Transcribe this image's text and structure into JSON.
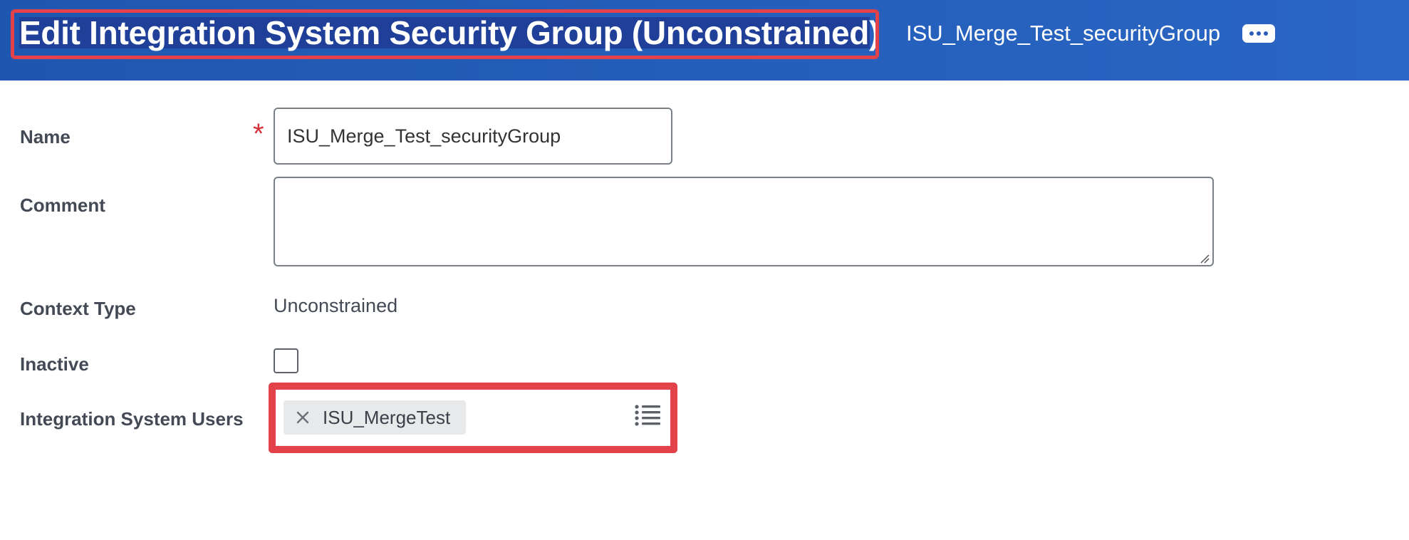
{
  "header": {
    "title": "Edit Integration System Security Group (Unconstrained)",
    "subtitle": "ISU_Merge_Test_securityGroup",
    "more_icon": "ellipsis-icon",
    "colors": {
      "background": "#2a66c4",
      "highlight_border": "#e3424a",
      "title_selection": "#1f3f99"
    }
  },
  "form": {
    "name": {
      "label": "Name",
      "required_marker": "*",
      "value": "ISU_Merge_Test_securityGroup"
    },
    "comment": {
      "label": "Comment",
      "value": ""
    },
    "context_type": {
      "label": "Context Type",
      "value": "Unconstrained"
    },
    "inactive": {
      "label": "Inactive",
      "checked": false
    },
    "integration_system_users": {
      "label": "Integration System Users",
      "selected": [
        {
          "label": "ISU_MergeTest",
          "remove_icon": "close-icon"
        }
      ],
      "prompt_icon": "list-icon"
    }
  }
}
